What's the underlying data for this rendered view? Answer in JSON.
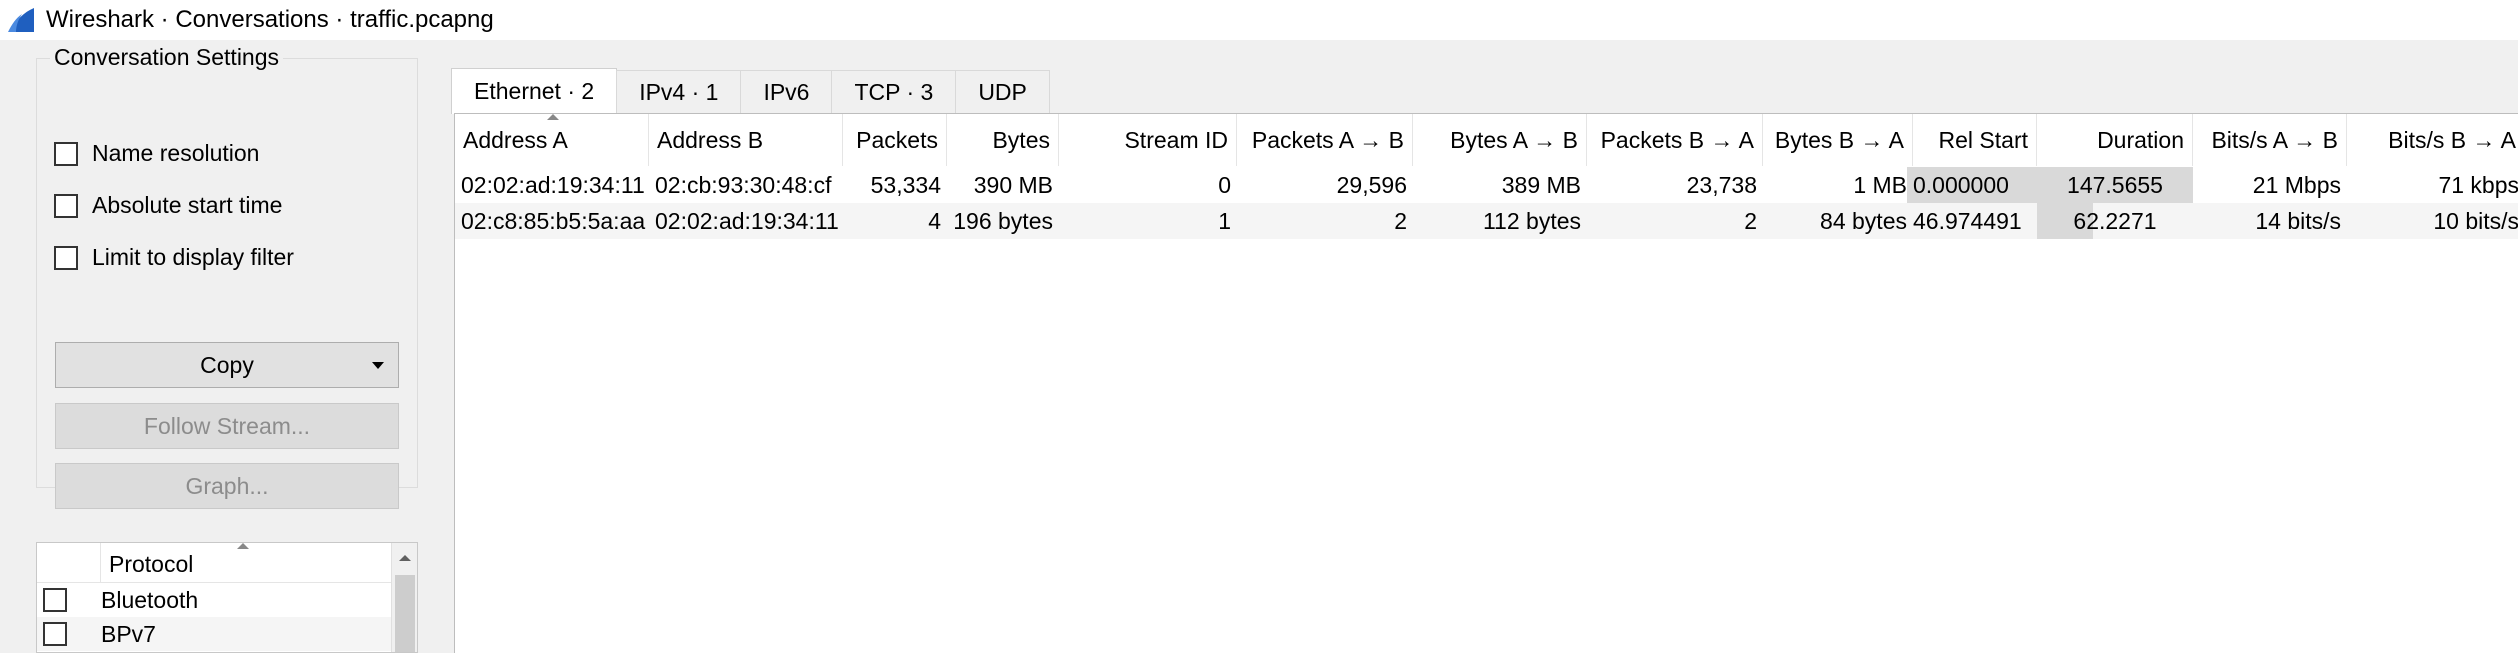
{
  "window": {
    "title": "Wireshark · Conversations · traffic.pcapng"
  },
  "settings": {
    "group_title": "Conversation Settings",
    "name_resolution": "Name resolution",
    "absolute_start_time": "Absolute start time",
    "limit_to_display_filter": "Limit to display filter",
    "copy_label": "Copy",
    "follow_stream_label": "Follow Stream...",
    "graph_label": "Graph..."
  },
  "protocols": {
    "header": "Protocol",
    "items": [
      "Bluetooth",
      "BPv7"
    ]
  },
  "tabs": [
    "Ethernet · 2",
    "IPv4 · 1",
    "IPv6",
    "TCP · 3",
    "UDP"
  ],
  "table": {
    "columns": [
      "Address A",
      "Address B",
      "Packets",
      "Bytes",
      "Stream ID",
      "Packets A → B",
      "Bytes A → B",
      "Packets B → A",
      "Bytes B → A",
      "Rel Start",
      "Duration",
      "Bits/s A → B",
      "Bits/s B → A"
    ],
    "rows": [
      [
        "02:02:ad:19:34:11",
        "02:cb:93:30:48:cf",
        "53,334",
        "390 MB",
        "0",
        "29,596",
        "389 MB",
        "23,738",
        "1 MB",
        "0.000000",
        "147.5655",
        "21 Mbps",
        "71 kbps"
      ],
      [
        "02:c8:85:b5:5a:aa",
        "02:02:ad:19:34:11",
        "4",
        "196 bytes",
        "1",
        "2",
        "112 bytes",
        "2",
        "84 bytes",
        "46.974491",
        "62.2271",
        "14 bits/s",
        "10 bits/s"
      ]
    ]
  },
  "colors": {
    "accent": "#1f5fbf",
    "bar_fill": "#d9d9d9"
  }
}
